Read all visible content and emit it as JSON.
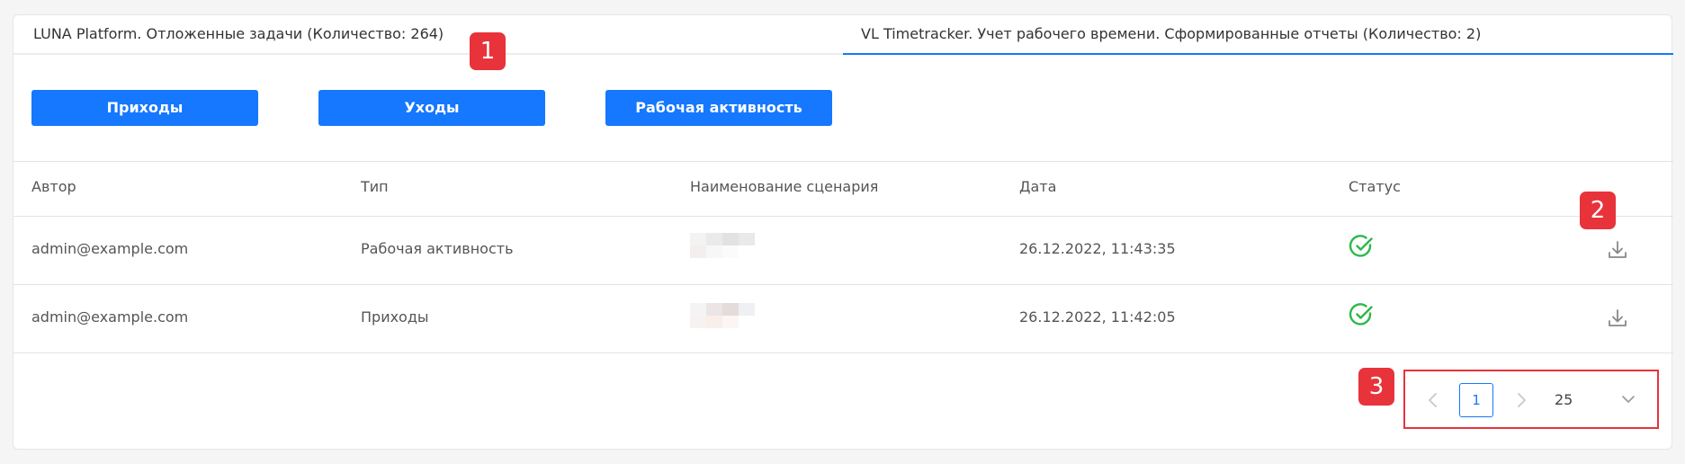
{
  "tabs": [
    {
      "label": "LUNA Platform. Отложенные задачи (Количество: 264)"
    },
    {
      "label": "VL Timetracker. Учет рабочего времени. Сформированные отчеты (Количество: 2)"
    }
  ],
  "buttons": {
    "arrivals": "Приходы",
    "departures": "Уходы",
    "activity": "Рабочая активность"
  },
  "table": {
    "headers": {
      "author": "Автор",
      "type": "Тип",
      "scenario": "Наименование сценария",
      "date": "Дата",
      "status": "Статус"
    },
    "rows": [
      {
        "author": "admin@example.com",
        "type": "Рабочая активность",
        "date": "26.12.2022, 11:43:35",
        "status_icon": "check-circle-icon"
      },
      {
        "author": "admin@example.com",
        "type": "Приходы",
        "date": "26.12.2022, 11:42:05",
        "status_icon": "check-circle-icon"
      }
    ]
  },
  "pagination": {
    "current_page": "1",
    "page_size": "25"
  },
  "annotations": [
    "1",
    "2",
    "3"
  ],
  "colors": {
    "accent": "#1677ff",
    "success": "#2eb84a",
    "annotation": "#e8333b"
  }
}
